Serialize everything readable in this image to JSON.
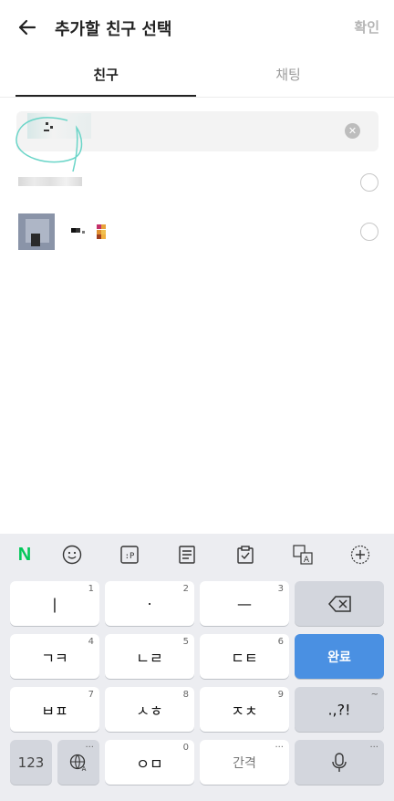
{
  "header": {
    "title": "추가할 친구 선택",
    "confirm": "확인"
  },
  "tabs": [
    {
      "label": "친구"
    },
    {
      "label": "채팅"
    }
  ],
  "colors": {
    "accent": "#4a90e2",
    "naver": "#03c75a"
  },
  "keyboard": {
    "rows": [
      {
        "keys": [
          {
            "label": "|",
            "hint": "1"
          },
          {
            "label": "·",
            "hint": "2"
          },
          {
            "label": "—",
            "hint": "3"
          }
        ]
      },
      {
        "keys": [
          {
            "label": "ㄱㅋ",
            "hint": "4"
          },
          {
            "label": "ㄴㄹ",
            "hint": "5"
          },
          {
            "label": "ㄷㅌ",
            "hint": "6"
          }
        ]
      },
      {
        "keys": [
          {
            "label": "ㅂㅍ",
            "hint": "7"
          },
          {
            "label": "ㅅㅎ",
            "hint": "8"
          },
          {
            "label": "ㅈㅊ",
            "hint": "9"
          }
        ]
      }
    ],
    "done": "완료",
    "punct": ".,?!",
    "punct_hint": "~",
    "num": "123",
    "zero": "ㅇㅁ",
    "zero_hint": "0",
    "space": "간격",
    "more": "···"
  }
}
